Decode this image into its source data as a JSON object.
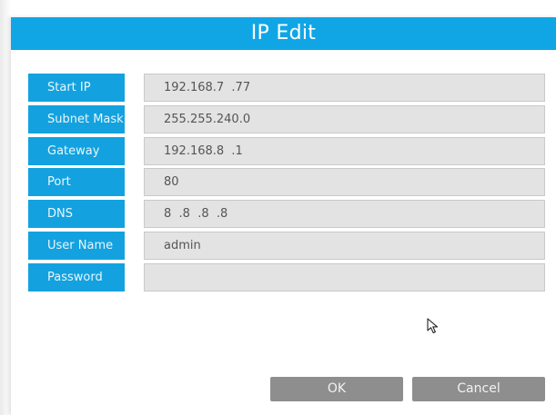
{
  "dialog": {
    "title": "IP Edit"
  },
  "fields": [
    {
      "label": "Start IP",
      "value": "192.168.7  .77"
    },
    {
      "label": "Subnet Mask",
      "value": "255.255.240.0"
    },
    {
      "label": "Gateway",
      "value": "192.168.8  .1"
    },
    {
      "label": "Port",
      "value": "80"
    },
    {
      "label": "DNS",
      "value": "8  .8  .8  .8"
    },
    {
      "label": "User Name",
      "value": "admin"
    },
    {
      "label": "Password",
      "value": ""
    }
  ],
  "buttons": {
    "ok_label": "OK",
    "cancel_label": "Cancel"
  },
  "colors": {
    "accent": "#10a6e6",
    "label_bg": "#13a2df",
    "field_bg": "#e3e3e3",
    "button_bg": "#8e8e8e"
  },
  "icons": {
    "cursor": "mouse-pointer-icon"
  }
}
